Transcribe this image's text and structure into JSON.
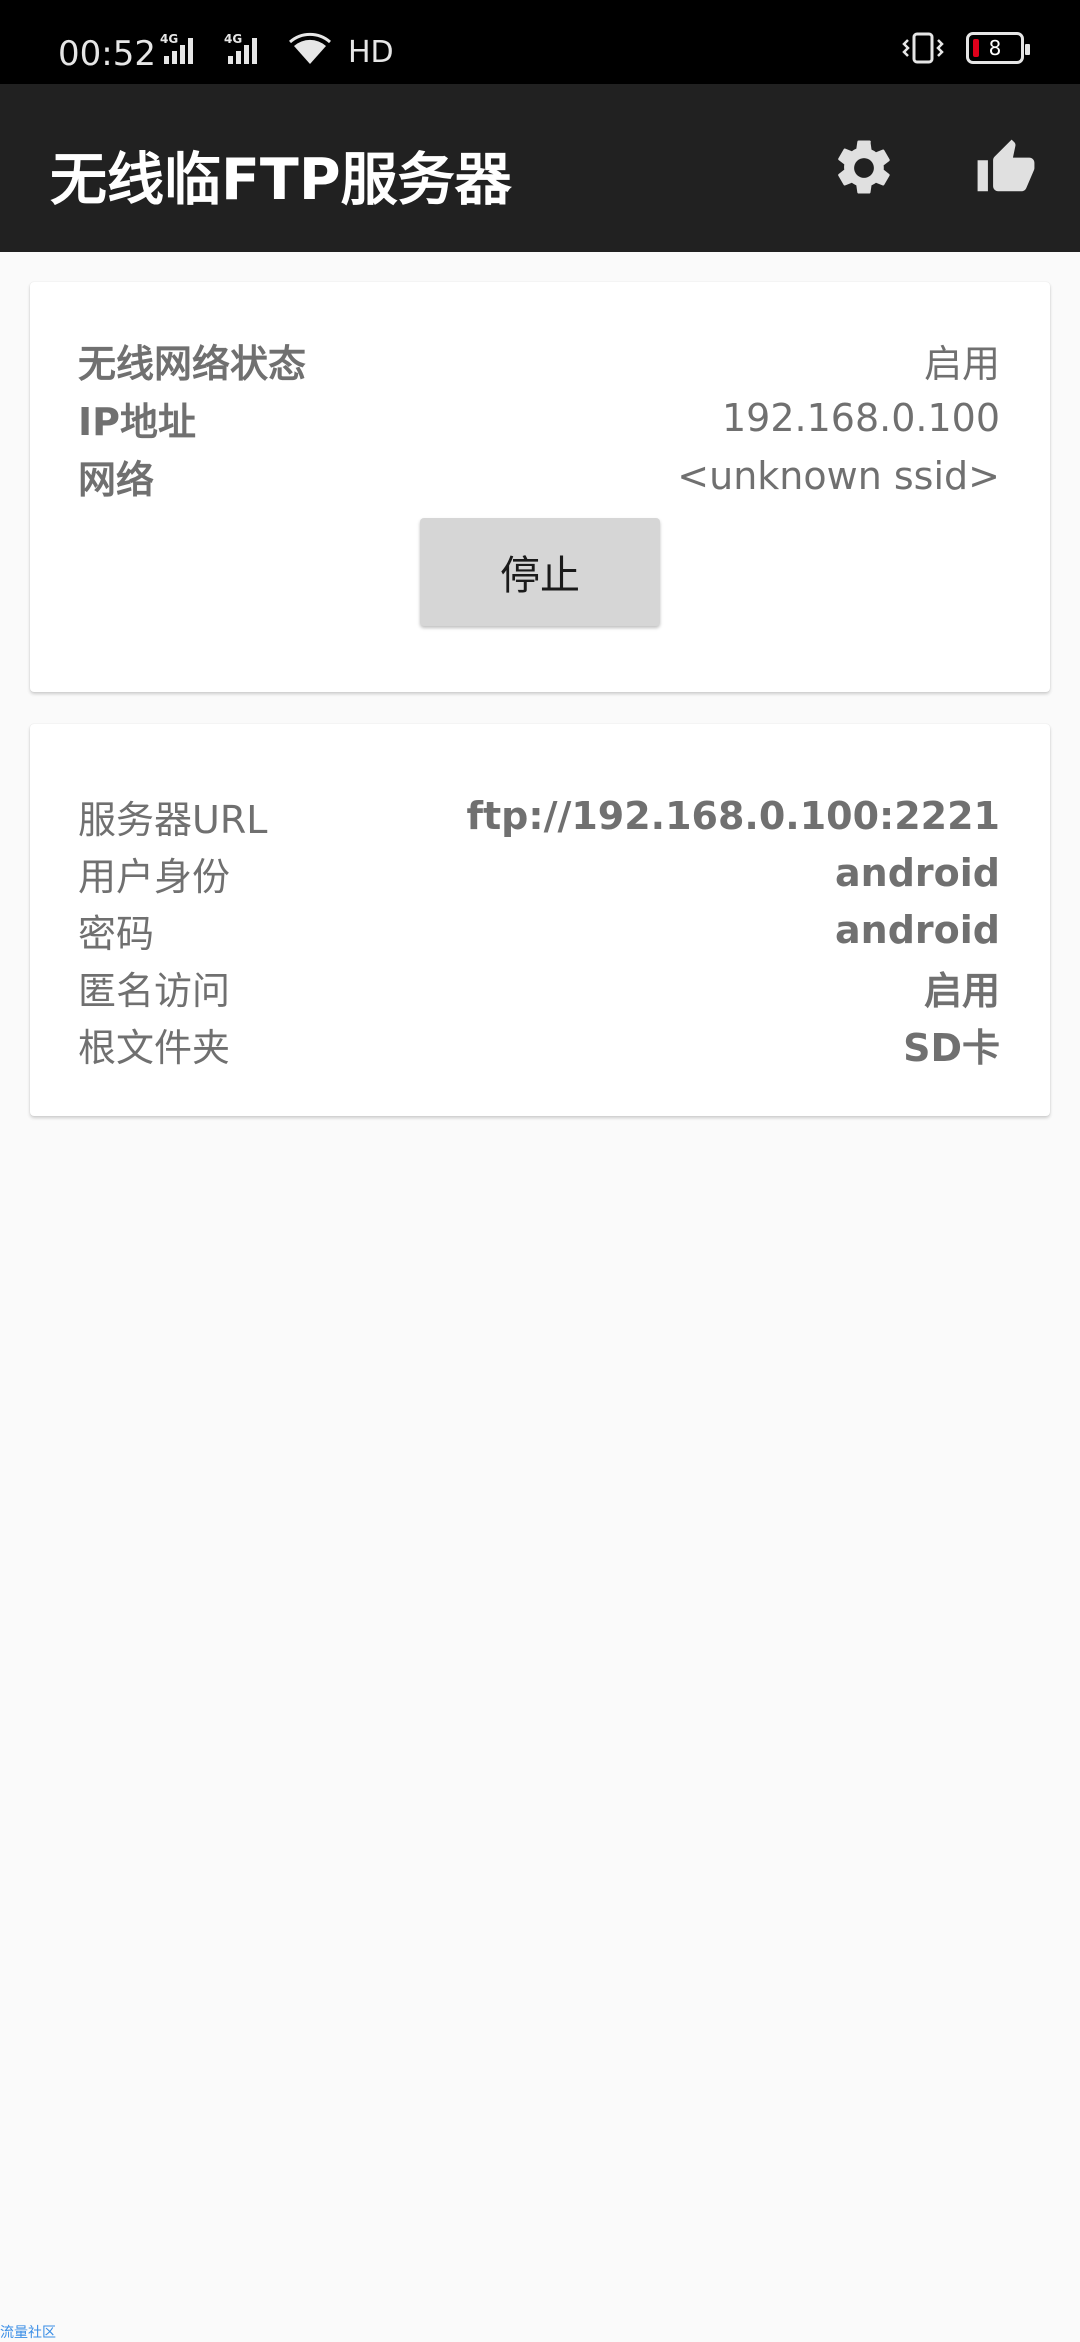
{
  "status_bar": {
    "time": "00:52",
    "network_1": "4G",
    "network_2": "4G",
    "hd_label": "HD",
    "battery_level": "8"
  },
  "app_bar": {
    "title": "无线临FTP服务器",
    "settings_icon": "gear-icon",
    "like_icon": "thumbs-up-icon"
  },
  "wifi_card": {
    "rows": [
      {
        "label": "无线网络状态",
        "value": "启用"
      },
      {
        "label": "IP地址",
        "value": "192.168.0.100"
      },
      {
        "label": "网络",
        "value": "<unknown ssid>"
      }
    ],
    "stop_button": "停止"
  },
  "server_card": {
    "rows": [
      {
        "label": "服务器URL",
        "value": "ftp://192.168.0.100:2221"
      },
      {
        "label": "用户身份",
        "value": "android"
      },
      {
        "label": "密码",
        "value": "android"
      },
      {
        "label": "匿名访问",
        "value": "启用"
      },
      {
        "label": "根文件夹",
        "value": "SD卡"
      }
    ]
  },
  "watermark": "流量社区",
  "colors": {
    "app_bar": "#212121",
    "status_bar": "#000000",
    "background": "#fafafa",
    "text_secondary": "#707070",
    "button": "#d6d6d6",
    "battery_low": "#e0001b"
  }
}
